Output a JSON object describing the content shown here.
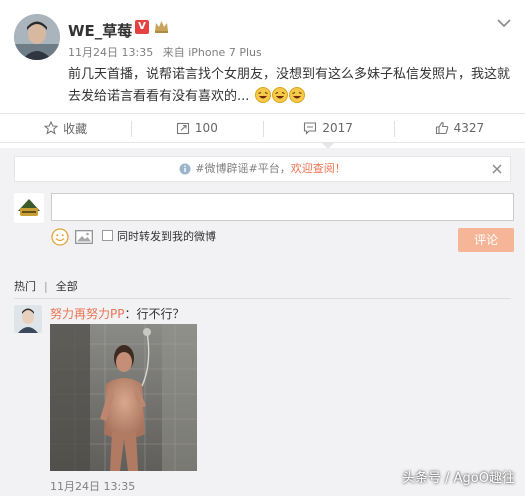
{
  "post": {
    "username": "WE_草莓丶",
    "vip_badge": "V",
    "date": "11月24日 13:35",
    "source": "来自 iPhone 7 Plus",
    "text": "前几天首播，说帮诺言找个女朋友，没想到有这么多妹子私信发照片，我这就去发给诺言看看有没有喜欢的..."
  },
  "actions": {
    "favorite_label": "收藏",
    "repost_count": "100",
    "comment_count": "2017",
    "like_count": "4327"
  },
  "comment_box": {
    "notice_prefix": "#微博辟谣#平台，",
    "notice_link": "欢迎查阅！",
    "input_value": "",
    "repost_label": "同时转发到我的微博",
    "submit_label": "评论"
  },
  "filters": {
    "hot": "热门",
    "all": "全部"
  },
  "reply": {
    "user": "努力再努力PP",
    "text": "：行不行？",
    "time": "11月24日 13:35"
  },
  "watermark": "头条号 / AgoO趣往",
  "colors": {
    "accent": "#eb7350",
    "vip": "#e64141",
    "submit_disabled": "#f5b596"
  }
}
